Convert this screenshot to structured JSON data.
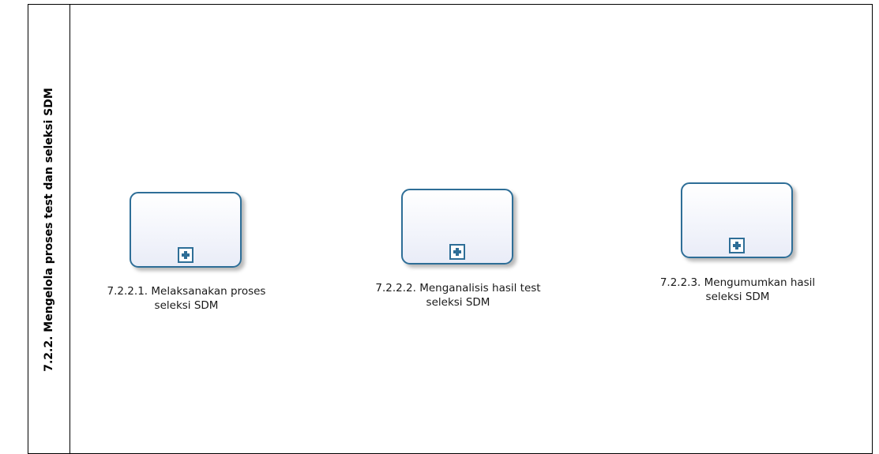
{
  "lane": {
    "title": "7.2.2. Mengelola proses test dan seleksi SDM"
  },
  "tasks": [
    {
      "line1": "7.2.2.1. Melaksanakan proses",
      "line2": "seleksi SDM",
      "icon": "subprocess-plus-icon"
    },
    {
      "line1": "7.2.2.2. Menganalisis hasil test",
      "line2": "seleksi SDM",
      "icon": "subprocess-plus-icon"
    },
    {
      "line1": "7.2.2.3. Mengumumkan hasil",
      "line2": "seleksi SDM",
      "icon": "subprocess-plus-icon"
    }
  ],
  "colors": {
    "task_border": "#2e6e97",
    "task_fill": "#f2f4fb"
  }
}
